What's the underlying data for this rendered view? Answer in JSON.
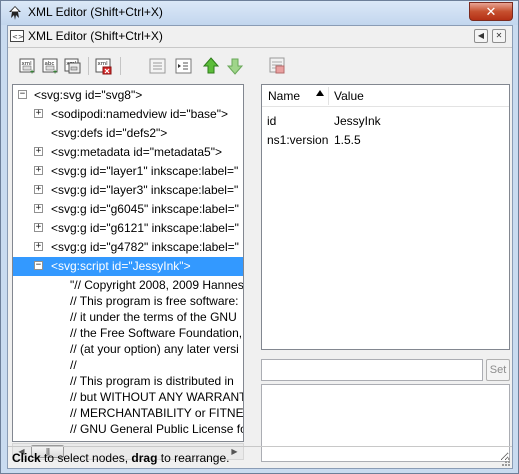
{
  "window": {
    "title": "XML Editor (Shift+Ctrl+X)",
    "close_glyph": "✕"
  },
  "dock": {
    "title": "XML Editor (Shift+Ctrl+X)",
    "iconify_glyph": "◀",
    "close_glyph": "✕"
  },
  "toolbar": {
    "buttons": [
      {
        "name": "new-element-node",
        "icon": "new-element-node-icon"
      },
      {
        "name": "new-text-node",
        "icon": "new-text-node-icon"
      },
      {
        "name": "duplicate-node",
        "icon": "duplicate-node-icon"
      },
      {
        "name": "delete-node",
        "icon": "delete-node-icon"
      },
      {
        "name": "unindent-node",
        "icon": "unindent-node-icon"
      },
      {
        "name": "indent-node",
        "icon": "indent-node-icon"
      },
      {
        "name": "raise-node",
        "icon": "raise-node-icon"
      },
      {
        "name": "lower-node",
        "icon": "lower-node-icon"
      }
    ],
    "delete_attribute_icon": "delete-attribute-icon"
  },
  "tree": {
    "nodes": [
      {
        "label": "<svg:svg id=\"svg8\">",
        "expander": "−",
        "depth": 0,
        "selected": false
      },
      {
        "label": "<sodipodi:namedview id=\"base\">",
        "expander": "+",
        "depth": 1,
        "selected": false
      },
      {
        "label": "<svg:defs id=\"defs2\">",
        "expander": "",
        "depth": 1,
        "selected": false
      },
      {
        "label": "<svg:metadata id=\"metadata5\">",
        "expander": "+",
        "depth": 1,
        "selected": false
      },
      {
        "label": "<svg:g id=\"layer1\" inkscape:label=\"",
        "expander": "+",
        "depth": 1,
        "selected": false
      },
      {
        "label": "<svg:g id=\"layer3\" inkscape:label=\"",
        "expander": "+",
        "depth": 1,
        "selected": false
      },
      {
        "label": "<svg:g id=\"g6045\" inkscape:label=\"",
        "expander": "+",
        "depth": 1,
        "selected": false
      },
      {
        "label": "<svg:g id=\"g6121\" inkscape:label=\"",
        "expander": "+",
        "depth": 1,
        "selected": false
      },
      {
        "label": "<svg:g id=\"g4782\" inkscape:label=\"",
        "expander": "+",
        "depth": 1,
        "selected": false
      },
      {
        "label": "<svg:script id=\"JessyInk\">",
        "expander": "−",
        "depth": 1,
        "selected": true
      }
    ],
    "text_lines": [
      "\"// Copyright 2008, 2009 Hannes",
      "// This program is free software:",
      "// it under the terms of the GNU",
      "// the Free Software Foundation,",
      "// (at your option) any later versi",
      "//",
      "// This program is distributed in",
      "// but WITHOUT ANY WARRANT",
      "// MERCHANTABILITY or FITNES",
      "// GNU General Public License fo"
    ],
    "scroll_thumb_grip": "|||"
  },
  "attributes": {
    "col_name": "Name",
    "col_value": "Value",
    "rows": [
      {
        "name": "id",
        "value": "JessyInk"
      },
      {
        "name": "ns1:version",
        "value": "1.5.5"
      }
    ],
    "name_entry": "",
    "set_label": "Set",
    "value_entry": "",
    "splitter_grip": "• • • • •"
  },
  "status": {
    "click_word": "Click",
    "middle": " to select nodes, ",
    "drag_word": "drag",
    "end": " to rearrange."
  }
}
